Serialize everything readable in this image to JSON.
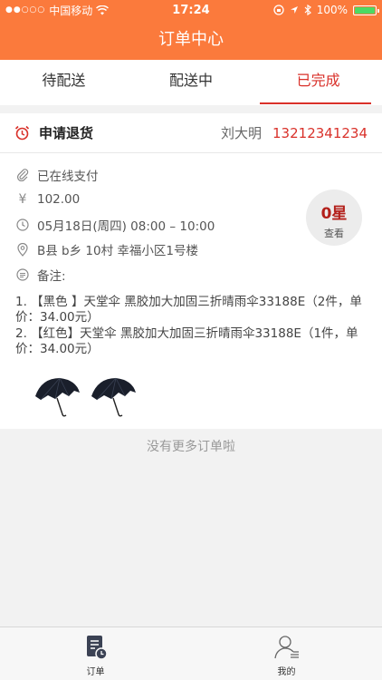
{
  "status_bar": {
    "carrier": "中国移动",
    "time": "17:24",
    "battery_percent": "100%",
    "battery_level": 1.0
  },
  "header": {
    "title": "订单中心"
  },
  "tabs": [
    {
      "label": "待配送",
      "active": false
    },
    {
      "label": "配送中",
      "active": false
    },
    {
      "label": "已完成",
      "active": true
    }
  ],
  "order": {
    "status": "申请退货",
    "customer_name": "刘大明",
    "phone": "13212341234",
    "payment": "已在线支付",
    "price": "102.00",
    "delivery_time": "05月18日(周四) 08:00 – 10:00",
    "address": "B县 b乡 10村 幸福小区1号楼",
    "note_label": "备注:",
    "items": [
      "1. 【黑色 】天堂伞 黑胶加大加固三折晴雨伞33188E（2件，单价：34.00元）",
      "2. 【红色】天堂伞 黑胶加大加固三折晴雨伞33188E（1件，单价：34.00元）"
    ],
    "rating_value": "0星",
    "rating_action": "查看"
  },
  "list_footer": "没有更多订单啦",
  "tab_bar": [
    {
      "label": "订单",
      "icon": "order-icon",
      "active": true
    },
    {
      "label": "我的",
      "icon": "profile-icon",
      "active": false
    }
  ],
  "colors": {
    "brand": "#fb7a3c",
    "accent_red": "#d9312a"
  }
}
